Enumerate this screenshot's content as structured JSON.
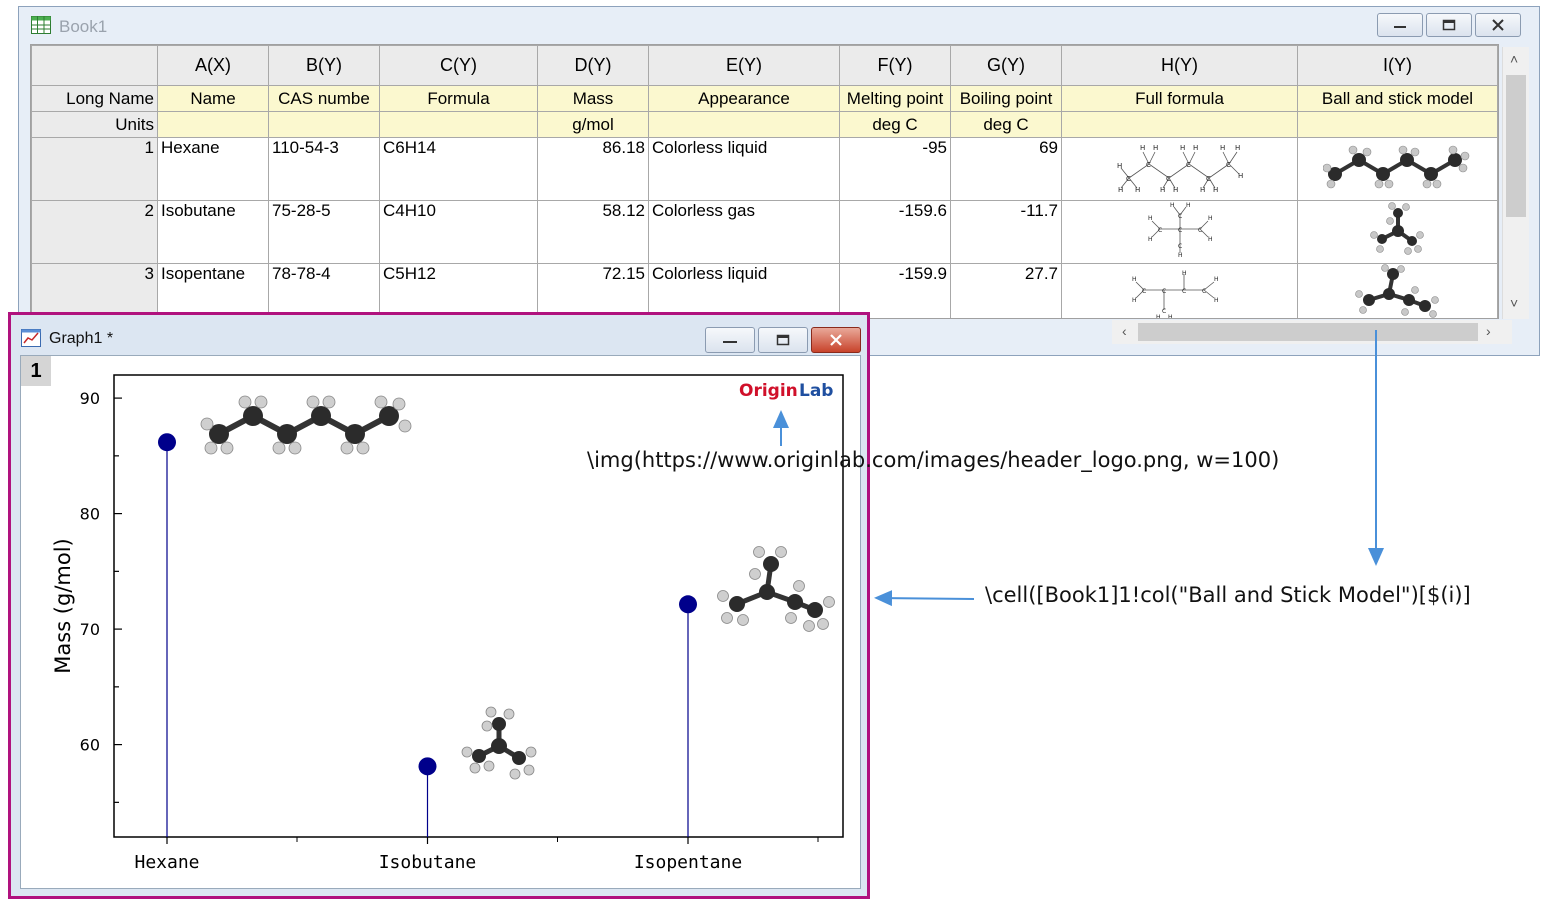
{
  "workbook": {
    "title": "Book1",
    "column_headers": [
      "",
      "A(X)",
      "B(Y)",
      "C(Y)",
      "D(Y)",
      "E(Y)",
      "F(Y)",
      "G(Y)",
      "H(Y)",
      "I(Y)"
    ],
    "long_name_label": "Long Name",
    "long_names": [
      "Name",
      "CAS numbe",
      "Formula",
      "Mass",
      "Appearance",
      "Melting point",
      "Boiling point",
      "Full formula",
      "Ball and stick model"
    ],
    "units_label": "Units",
    "units": [
      "",
      "",
      "",
      "g/mol",
      "",
      "deg C",
      "deg C",
      "",
      ""
    ],
    "rows": [
      {
        "index": "1",
        "name": "Hexane",
        "cas": "110-54-3",
        "formula": "C6H14",
        "mass": "86.18",
        "appearance": "Colorless liquid",
        "mp": "-95",
        "bp": "69"
      },
      {
        "index": "2",
        "name": "Isobutane",
        "cas": "75-28-5",
        "formula": "C4H10",
        "mass": "58.12",
        "appearance": "Colorless gas",
        "mp": "-159.6",
        "bp": "-11.7"
      },
      {
        "index": "3",
        "name": "Isopentane",
        "cas": "78-78-4",
        "formula": "C5H12",
        "mass": "72.15",
        "appearance": "Colorless liquid",
        "mp": "-159.9",
        "bp": "27.7"
      }
    ]
  },
  "graph": {
    "title": "Graph1 *",
    "layer": "1",
    "logo_text_origin": "Origin",
    "logo_text_lab": "Lab"
  },
  "annotations": {
    "img_code": "\\img(https://www.originlab.com/images/header_logo.png, w=100)",
    "cell_code": "\\cell([Book1]1!col(\"Ball and Stick Model\")[$(i)]"
  },
  "colors": {
    "marker": "#00008b",
    "frame": "#b0127e",
    "arrow": "#4a90d9",
    "yellow_header": "#fbf8cf"
  },
  "chart_data": {
    "type": "scatter",
    "style": "drop-lines",
    "categories": [
      "Hexane",
      "Isobutane",
      "Isopentane"
    ],
    "values": [
      86.18,
      58.12,
      72.15
    ],
    "ylabel": "Mass (g/mol)",
    "xlabel": "",
    "ylim": [
      52,
      92
    ],
    "yticks": [
      60,
      70,
      80,
      90
    ],
    "grid": false
  }
}
